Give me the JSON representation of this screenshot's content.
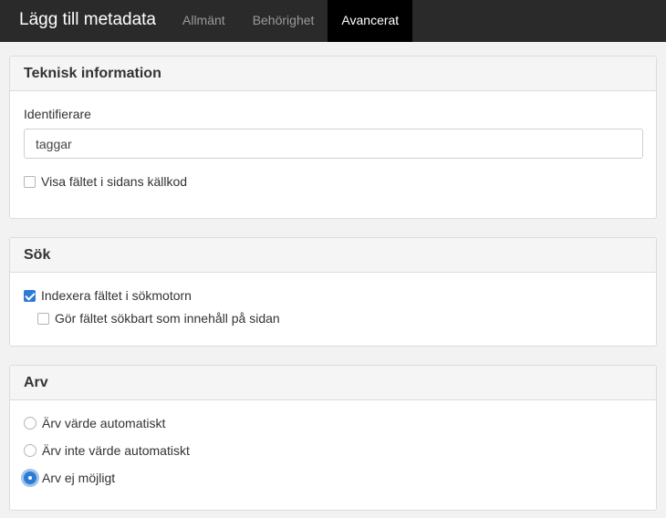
{
  "header": {
    "title": "Lägg till metadata",
    "tabs": [
      {
        "label": "Allmänt",
        "active": false
      },
      {
        "label": "Behörighet",
        "active": false
      },
      {
        "label": "Avancerat",
        "active": true
      }
    ]
  },
  "technical": {
    "heading": "Teknisk information",
    "identifier_label": "Identifierare",
    "identifier_value": "taggar",
    "show_in_source": {
      "label": "Visa fältet i sidans källkod",
      "checked": false
    }
  },
  "search": {
    "heading": "Sök",
    "index_field": {
      "label": "Indexera fältet i sökmotorn",
      "checked": true
    },
    "searchable_content": {
      "label": "Gör fältet sökbart som innehåll på sidan",
      "checked": false
    }
  },
  "inheritance": {
    "heading": "Arv",
    "options": [
      {
        "label": "Ärv värde automatiskt",
        "selected": false
      },
      {
        "label": "Ärv inte värde automatiskt",
        "selected": false
      },
      {
        "label": "Arv ej möjligt",
        "selected": true
      }
    ]
  },
  "colors": {
    "topbar": "#2a2a2a",
    "active_tab": "#000000",
    "accent": "#2e7bd6"
  }
}
